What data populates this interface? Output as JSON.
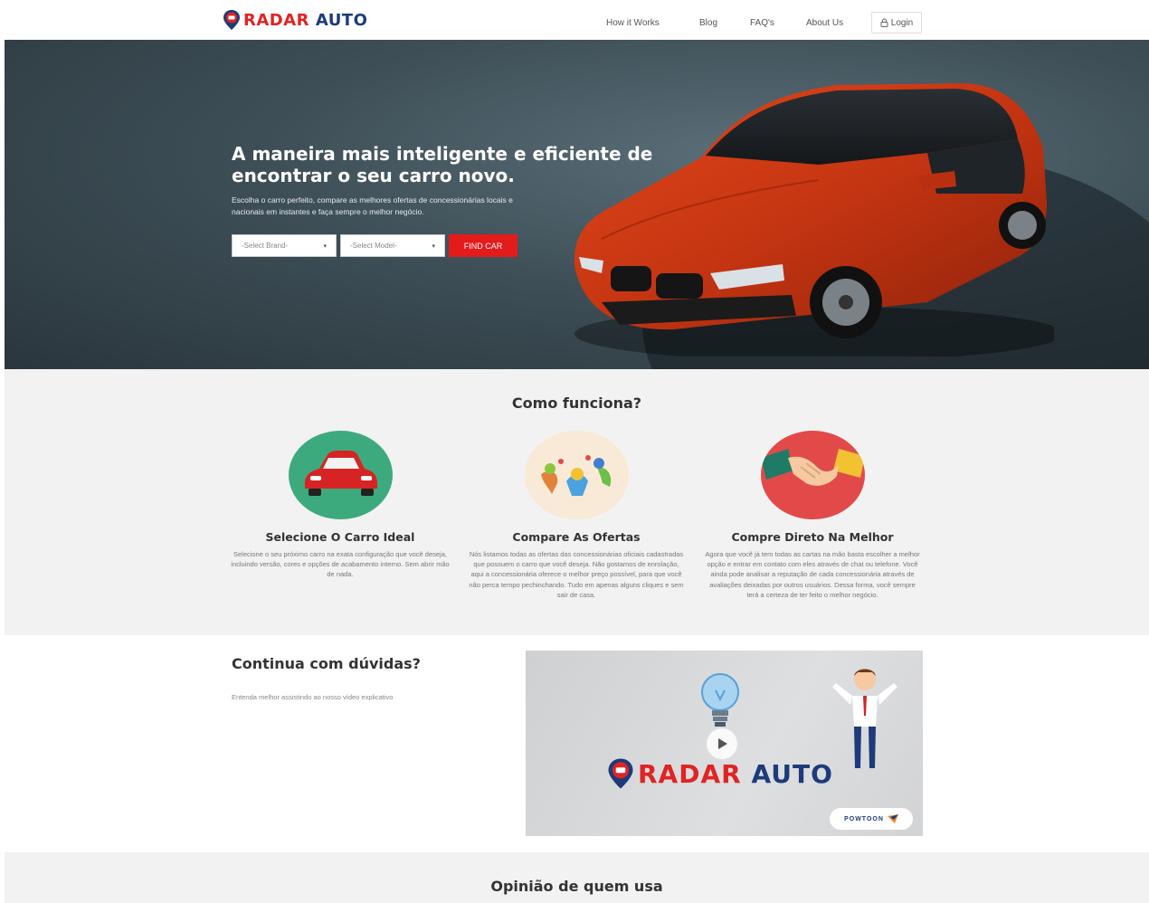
{
  "header": {
    "logo_part1": "RADAR",
    "logo_part2": "AUTO",
    "nav": [
      {
        "label": "How it Works"
      },
      {
        "label": "Blog"
      },
      {
        "label": "FAQ's"
      },
      {
        "label": "About Us"
      }
    ],
    "login_label": "Login"
  },
  "hero": {
    "title": "A maneira mais inteligente e eficiente de encontrar o seu carro novo.",
    "subtitle": "Escolha o carro perfeito, compare as melhores ofertas de concessionárias locais e nacionais em instantes e faça sempre o melhor negócio.",
    "brand_select": "-Select Brand-",
    "model_select": "-Select Model-",
    "find_button": "FIND CAR"
  },
  "how": {
    "title": "Como funciona?",
    "features": [
      {
        "title": "Selecione O Carro Ideal",
        "text": "Selecione o seu próximo carro na exata configuração que você deseja, incluindo versão, cores e opções de acabamento interno. Sem abrir mão de nada."
      },
      {
        "title": "Compare As Ofertas",
        "text": "Nós listamos todas as ofertas das concessionárias oficiais cadastradas que possuem o carro que você deseja. Não gostamos de enrolação, aqui a concessionária oferece o melhor preço possível, para que você não perca tempo pechinchando. Tudo em apenas alguns cliques e sem sair de casa."
      },
      {
        "title": "Compre Direto Na Melhor",
        "text": "Agora que você já tem todas as cartas na mão basta escolher a melhor opção e entrar em contato com eles através de chat ou telefone. Você ainda pode analisar a reputação de cada concessionária através de avaliações deixadas por outros usuários. Dessa forma, você sempre terá a certeza de ter feito o melhor negócio."
      }
    ]
  },
  "doubts": {
    "title": "Continua com dúvidas?",
    "text": "Entenda melhor assistindo ao nosso vídeo explicativo",
    "video_logo_part1": "RADAR",
    "video_logo_part2": "AUTO",
    "powtoon_label": "POWTOON"
  },
  "opinion": {
    "title": "Opinião de quem usa"
  },
  "colors": {
    "accent_red": "#e41b1b",
    "brand_blue": "#1d3b7a",
    "section_bg": "#f2f2f2"
  },
  "icons": [
    "location-pin-icon",
    "user-icon",
    "chevron-down-icon",
    "red-car-icon",
    "birds-icon",
    "handshake-icon",
    "lightbulb-icon",
    "businessman-icon",
    "play-icon"
  ]
}
